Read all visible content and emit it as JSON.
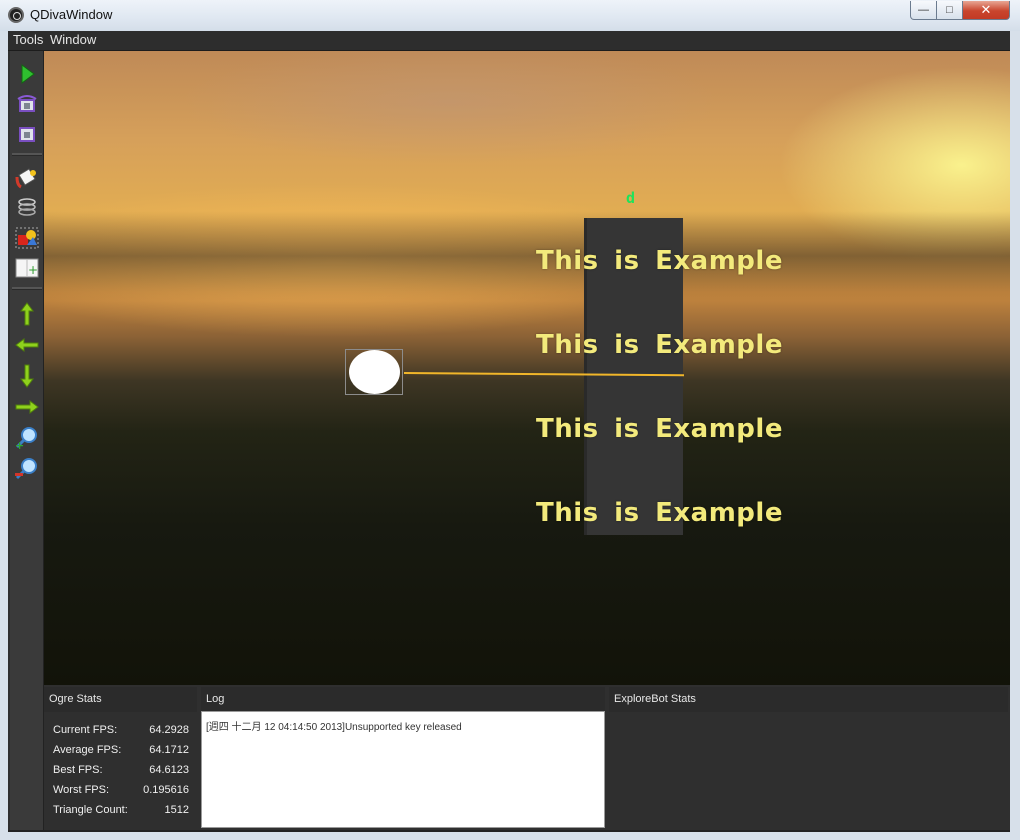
{
  "window": {
    "title": "QDivaWindow",
    "controls": {
      "minimize": "—",
      "maximize": "□",
      "close": "✕"
    }
  },
  "menu": [
    "Tools",
    "Window"
  ],
  "toolbar": {
    "tools": [
      {
        "name": "play-icon"
      },
      {
        "name": "camera-rotate-icon"
      },
      {
        "name": "camera-reset-icon"
      },
      {
        "name": "paint-bucket-icon"
      },
      {
        "name": "spring-icon"
      },
      {
        "name": "shapes-icon"
      },
      {
        "name": "add-panel-icon"
      },
      {
        "name": "arrow-up-icon"
      },
      {
        "name": "arrow-left-icon"
      },
      {
        "name": "arrow-down-icon"
      },
      {
        "name": "arrow-right-icon"
      },
      {
        "name": "zoom-in-icon"
      },
      {
        "name": "zoom-out-icon"
      }
    ]
  },
  "viewport": {
    "node_label": "d",
    "example_texts": [
      "This is Example",
      "This is Example",
      "This is Example",
      "This is Example"
    ],
    "colors": {
      "text": "#f3ea7c",
      "label": "#1fe35a",
      "link": "#f1b62a"
    }
  },
  "ogre_stats": {
    "title": "Ogre Stats",
    "rows": [
      {
        "label": "Current FPS:",
        "value": "64.2928"
      },
      {
        "label": "Average FPS:",
        "value": "64.1712"
      },
      {
        "label": "Best FPS:",
        "value": "64.6123"
      },
      {
        "label": "Worst FPS:",
        "value": "0.195616"
      },
      {
        "label": "Triangle Count:",
        "value": "1512"
      }
    ]
  },
  "log": {
    "title": "Log",
    "lines": [
      "[週四 十二月 12 04:14:50 2013]Unsupported key released"
    ]
  },
  "explorebot": {
    "title": "ExploreBot Stats"
  }
}
